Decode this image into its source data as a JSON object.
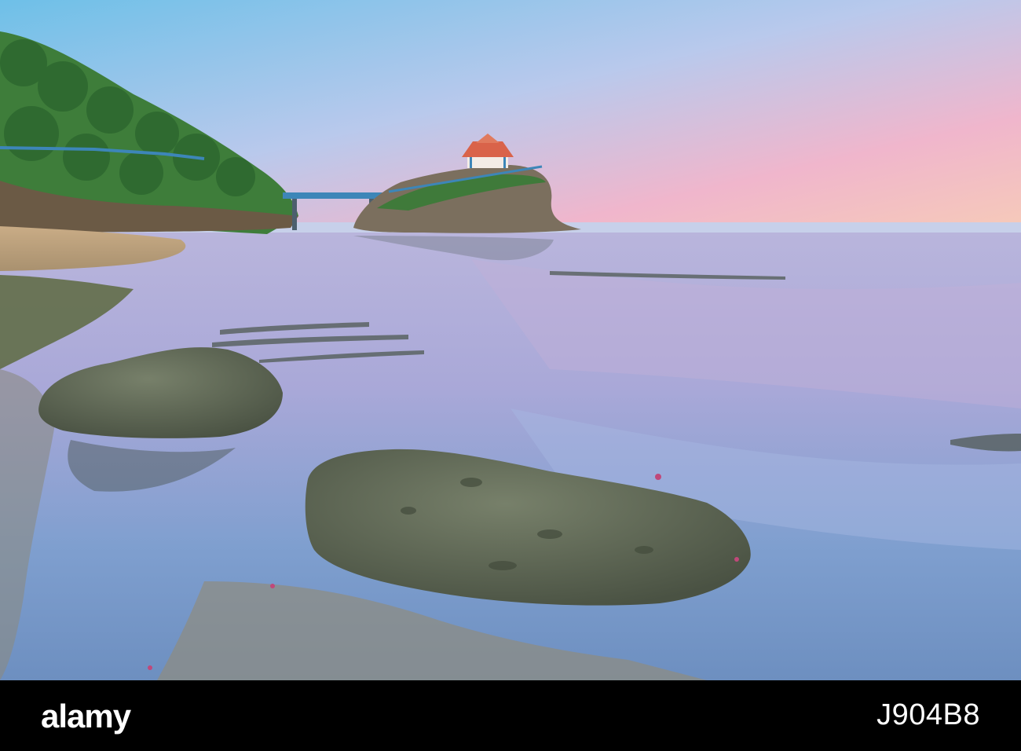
{
  "photo": {
    "scene": "coastal-rock-island-with-pavilion",
    "colors": {
      "sky_top": "#7fc3e6",
      "sky_pink": "#f2b3c8",
      "water": "#8ea6d6",
      "rock": "#5f6a55",
      "foliage": "#3f7a3a",
      "roof": "#d9634a",
      "railing": "#3d86b8"
    }
  },
  "footer": {
    "logo": "alamy",
    "stock_id": "J904B8",
    "background": "#000000"
  }
}
